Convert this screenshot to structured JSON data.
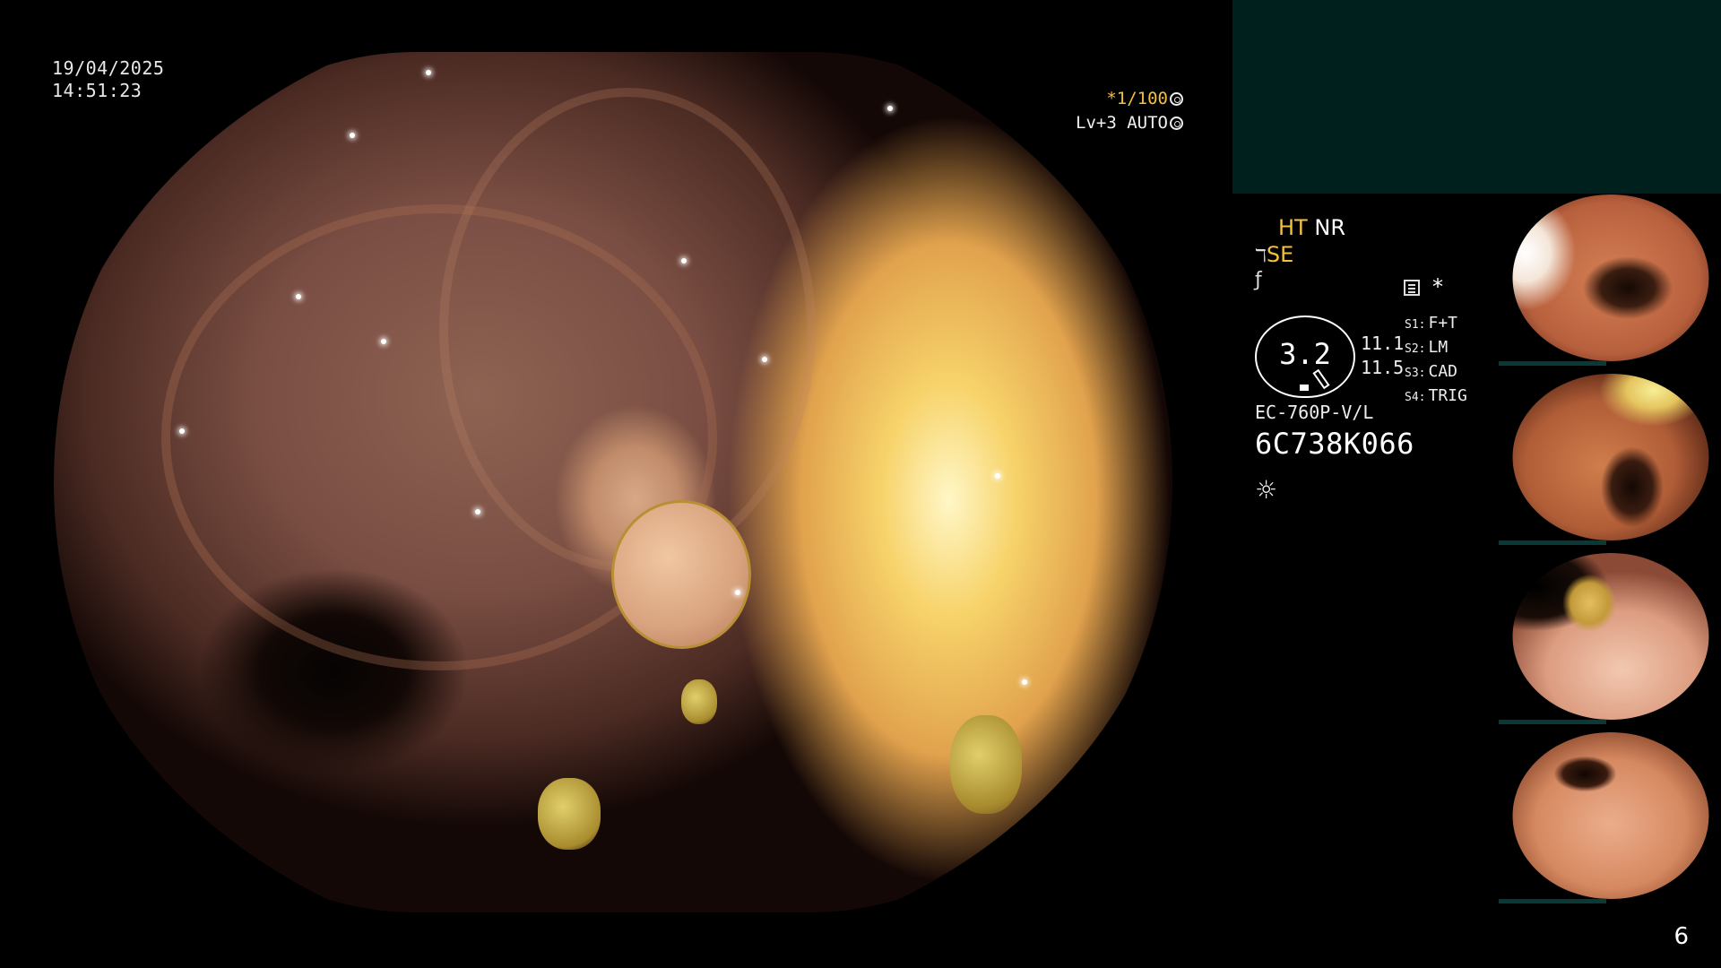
{
  "datetime": {
    "date": "19/04/2025",
    "time": "14:51:23"
  },
  "scope_settings": {
    "zoom": "*1/100",
    "level": "Lv+3 AUTO"
  },
  "modes": {
    "ht": "HT",
    "nr": "NR",
    "se": "SE"
  },
  "gauge": {
    "value": "3.2",
    "reading_top": "11.1",
    "reading_bottom": "11.5"
  },
  "switches": [
    {
      "tag": "S1:",
      "label": "F+T"
    },
    {
      "tag": "S2:",
      "label": "LM"
    },
    {
      "tag": "S3:",
      "label": "CAD"
    },
    {
      "tag": "S4:",
      "label": "TRIG"
    }
  ],
  "scope": {
    "model": "EC-760P-V/L",
    "serial": "6C738K066"
  },
  "icons": {
    "zoom": "aperture-icon",
    "level": "auto-exposure-icon",
    "se_glyph": "structure-enhancement-icon",
    "color": "color-mode-icon",
    "memo": "memo-icon",
    "star": "star-icon",
    "light": "light-source-icon"
  },
  "thumbnails": [
    {
      "name": "capture-1"
    },
    {
      "name": "capture-2"
    },
    {
      "name": "capture-3"
    },
    {
      "name": "capture-4"
    }
  ],
  "page_number": "6"
}
